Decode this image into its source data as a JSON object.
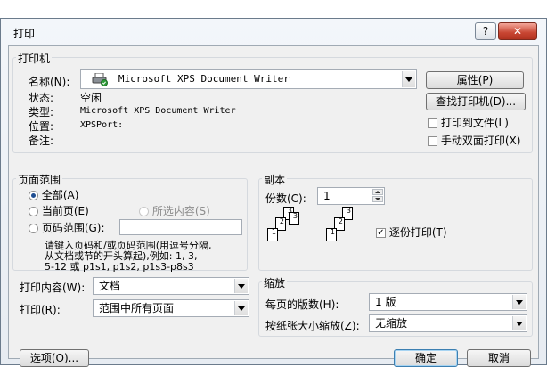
{
  "window": {
    "title": "打印",
    "help_label": "?",
    "close_label": "✕"
  },
  "printer": {
    "group_label": "打印机",
    "name_label": "名称(N):",
    "name_value": "Microsoft XPS Document Writer",
    "properties_button": "属性(P)",
    "find_button": "查找打印机(D)...",
    "status_label": "状态:",
    "status_value": "空闲",
    "type_label": "类型:",
    "type_value": "Microsoft XPS Document Writer",
    "where_label": "位置:",
    "where_value": "XPSPort:",
    "comment_label": "备注:",
    "print_to_file": "打印到文件(L)",
    "manual_duplex": "手动双面打印(X)"
  },
  "page_range": {
    "group_label": "页面范围",
    "all": "全部(A)",
    "current": "当前页(E)",
    "selection": "所选内容(S)",
    "pages": "页码范围(G):",
    "hint_line1": "请键入页码和/或页码范围(用逗号分隔,",
    "hint_line2": "从文档或节的开头算起),例如: 1, 3,",
    "hint_line3": "5-12 或 p1s1, p1s2, p1s3-p8s3"
  },
  "copies": {
    "group_label": "副本",
    "count_label": "份数(C):",
    "count_value": "1",
    "collate": "逐份打印(T)",
    "page_numbers": [
      "1",
      "2",
      "3"
    ]
  },
  "print_what": {
    "label": "打印内容(W):",
    "value": "文档"
  },
  "print": {
    "label": "打印(R):",
    "value": "范围中所有页面"
  },
  "zoom": {
    "group_label": "缩放",
    "pages_per_sheet_label": "每页的版数(H):",
    "pages_per_sheet_value": "1 版",
    "scale_label": "按纸张大小缩放(Z):",
    "scale_value": "无缩放"
  },
  "footer": {
    "options_button": "选项(O)...",
    "ok_button": "确定",
    "cancel_button": "取消"
  }
}
